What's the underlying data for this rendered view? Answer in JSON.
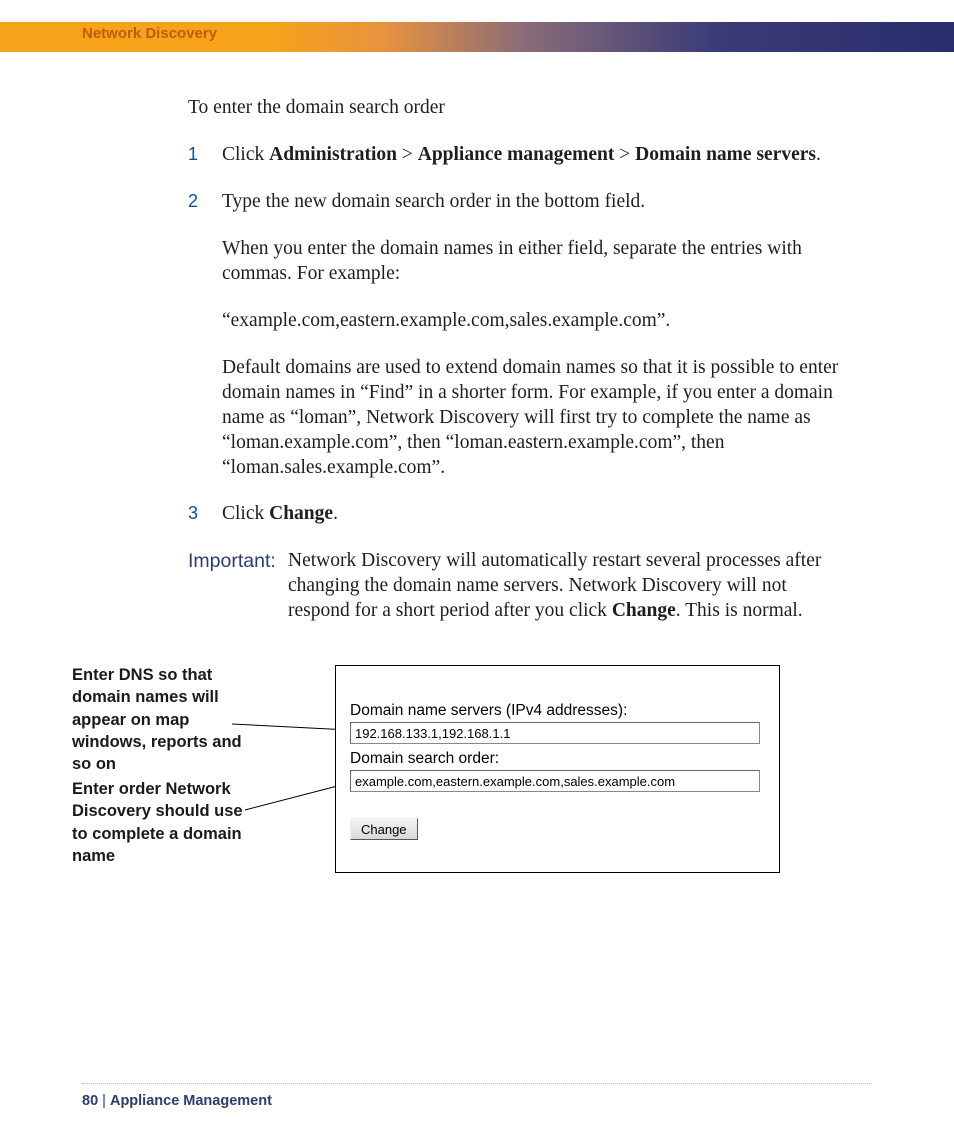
{
  "header": {
    "section": "Network Discovery"
  },
  "intro": "To enter the domain search order",
  "steps": {
    "s1": {
      "num": "1",
      "prefix": "Click ",
      "bc1": "Administration",
      "gt1": " > ",
      "bc2": "Appliance management",
      "gt2": " > ",
      "bc3": "Domain name servers",
      "suffix": "."
    },
    "s2": {
      "num": "2",
      "p1": "Type the new domain search order in the bottom field.",
      "p2": "When you enter the domain names in either field, separate the entries with commas. For example:",
      "p3": "“example.com,eastern.example.com,sales.example.com”.",
      "p4": "Default domains are used to extend domain names so that it is possible to enter domain names in “Find” in a shorter form. For example, if you enter a domain name as “loman”, Network Discovery will first try to complete the name as “loman.example.com”, then “loman.eastern.example.com”, then “loman.sales.example.com”."
    },
    "s3": {
      "num": "3",
      "prefix": "Click ",
      "bold": "Change",
      "suffix": "."
    }
  },
  "important": {
    "label": "Important:",
    "body_pre": "Network Discovery will automatically restart several processes after changing the domain name servers. Network Discovery will not respond for a short period after you click ",
    "body_bold": "Change",
    "body_post": ". This is normal."
  },
  "callouts": {
    "c1": "Enter DNS so that domain names will appear on map windows, reports and so on",
    "c2": "Enter order Network Discovery should use to complete a domain name"
  },
  "panel": {
    "dns_label": "Domain name servers (IPv4 addresses):",
    "dns_value": "192.168.133.1,192.168.1.1",
    "order_label": "Domain search order:",
    "order_value": "example.com,eastern.example.com,sales.example.com",
    "change_btn": "Change"
  },
  "footer": {
    "page": "80",
    "sep": " | ",
    "title": "Appliance Management"
  }
}
